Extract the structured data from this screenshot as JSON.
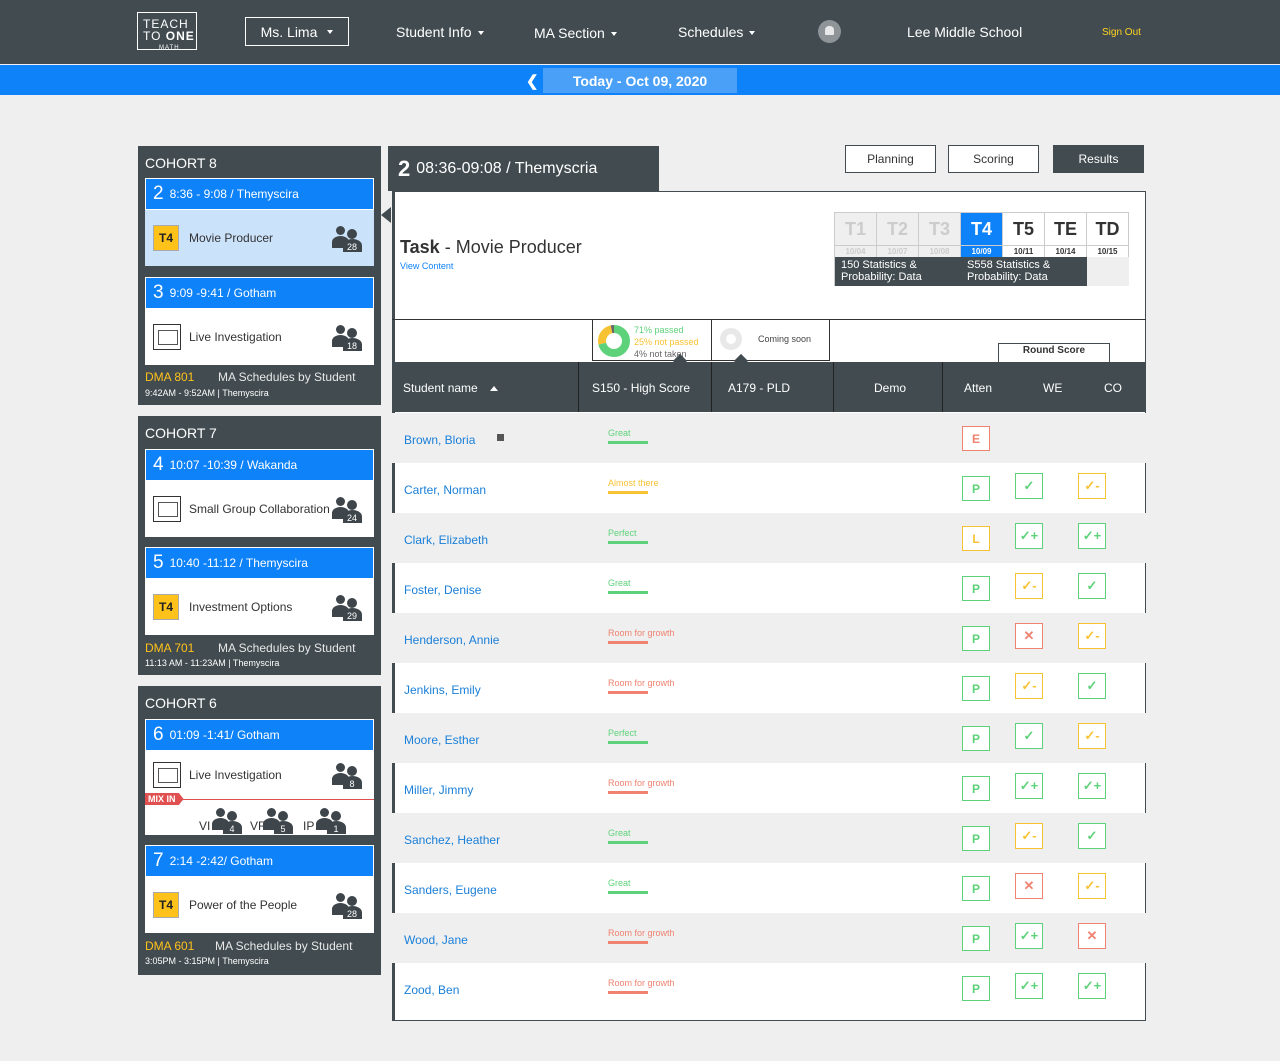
{
  "header": {
    "logo": {
      "line1": "TEACH",
      "line2a": "TO",
      "line2b": "ONE",
      "line3": "MATH"
    },
    "teacher": "Ms. Lima",
    "nav": [
      "Student Info",
      "MA Section",
      "Schedules"
    ],
    "school": "Lee Middle School",
    "signout": "Sign Out"
  },
  "datebar": {
    "date": "Today - Oct 09, 2020",
    "back_icon": "chevron-left-icon"
  },
  "cohorts": [
    {
      "title": "COHORT 8",
      "sessions": [
        {
          "num": "2",
          "time": "8:36 - 9:08 / Themyscira",
          "badge": "T4",
          "activity": "Movie Producer",
          "count": "28"
        },
        {
          "num": "3",
          "time": "9:09 -9:41 / Gotham",
          "badge": "",
          "activity": "Live Investigation",
          "count": "18"
        }
      ],
      "code": "DMA 801",
      "label": "MA Schedules by Student",
      "footer_time": "9:42AM - 9:52AM | Themyscira"
    },
    {
      "title": "COHORT 7",
      "sessions": [
        {
          "num": "4",
          "time": "10:07 -10:39 / Wakanda",
          "badge": "",
          "activity": "Small Group Collaboration",
          "count": "24"
        },
        {
          "num": "5",
          "time": "10:40 -11:12 / Themyscira",
          "badge": "T4",
          "activity": "Investment Options",
          "count": "29"
        }
      ],
      "code": "DMA 701",
      "label": "MA Schedules by Student",
      "footer_time": "11:13 AM - 11:23AM | Themyscira"
    },
    {
      "title": "COHORT 6",
      "sessions": [
        {
          "num": "6",
          "time": "01:09 -1:41/ Gotham",
          "badge": "",
          "activity": "Live Investigation",
          "count": "8",
          "mixin": {
            "label": "MIX IN",
            "groups": [
              {
                "name": "VI",
                "count": "4"
              },
              {
                "name": "VR",
                "count": "5"
              },
              {
                "name": "IP",
                "count": "1"
              }
            ]
          }
        },
        {
          "num": "7",
          "time": "2:14 -2:42/ Gotham",
          "badge": "T4",
          "activity": "Power of the People",
          "count": "28"
        }
      ],
      "code": "DMA 601",
      "label": "MA Schedules by Student",
      "footer_time": "3:05PM - 3:15PM | Themyscira"
    }
  ],
  "main": {
    "session_num": "2",
    "session_title": "08:36-09:08 / Themyscria",
    "buttons": [
      "Planning",
      "Scoring",
      "Results"
    ],
    "task_label": "Task",
    "task_name": " - Movie Producer",
    "view_content": "View Content",
    "tiers": [
      {
        "name": "T1",
        "date": "10/04",
        "state": "past"
      },
      {
        "name": "T2",
        "date": "10/07",
        "state": "past"
      },
      {
        "name": "T3",
        "date": "10/08",
        "state": "past"
      },
      {
        "name": "T4",
        "date": "10/09",
        "state": "current"
      },
      {
        "name": "T5",
        "date": "10/11",
        "state": "future"
      },
      {
        "name": "TE",
        "date": "10/14",
        "state": "future"
      },
      {
        "name": "TD",
        "date": "10/15",
        "state": "future"
      }
    ],
    "tier_info": [
      "150 Statistics & Probability: Data",
      "S558 Statistics & Probability: Data"
    ],
    "pass_summary": {
      "passed": "71% passed",
      "not_passed": "25% not passed",
      "not_taken": "4% not taken",
      "passed_pct": 71,
      "not_passed_pct": 25,
      "not_taken_pct": 4
    },
    "coming_soon": "Coming soon",
    "round_score": "Round Score",
    "columns": [
      "Student name",
      "S150 - High Score",
      "A179 - PLD",
      "Demo",
      "Atten",
      "WE",
      "CO"
    ],
    "students": [
      {
        "name": "Brown, Bloria",
        "result": "Great",
        "atten": "E",
        "we": "",
        "co": ""
      },
      {
        "name": "Carter, Norman",
        "result": "Almost there",
        "atten": "P",
        "we": "✓",
        "co": "✓-"
      },
      {
        "name": "Clark, Elizabeth",
        "result": "Perfect",
        "atten": "L",
        "we": "✓+",
        "co": "✓+"
      },
      {
        "name": "Foster, Denise",
        "result": "Great",
        "atten": "P",
        "we": "✓-",
        "co": "✓"
      },
      {
        "name": "Henderson, Annie",
        "result": "Room for growth",
        "atten": "P",
        "we": "✕",
        "co": "✓-"
      },
      {
        "name": "Jenkins, Emily",
        "result": "Room for growth",
        "atten": "P",
        "we": "✓-",
        "co": "✓"
      },
      {
        "name": "Moore, Esther",
        "result": "Perfect",
        "atten": "P",
        "we": "✓",
        "co": "✓-"
      },
      {
        "name": "Miller, Jimmy",
        "result": "Room for growth",
        "atten": "P",
        "we": "✓+",
        "co": "✓+"
      },
      {
        "name": "Sanchez, Heather",
        "result": "Great",
        "atten": "P",
        "we": "✓-",
        "co": "✓"
      },
      {
        "name": "Sanders, Eugene",
        "result": "Great",
        "atten": "P",
        "we": "✕",
        "co": "✓-"
      },
      {
        "name": "Wood, Jane",
        "result": "Room for growth",
        "atten": "P",
        "we": "✓+",
        "co": "✕"
      },
      {
        "name": "Zood, Ben",
        "result": "Room for growth",
        "atten": "P",
        "we": "✓+",
        "co": "✓+"
      }
    ]
  },
  "colors": {
    "navy": "#414b50",
    "blue": "#0e82f8",
    "yellow": "#ffc21a",
    "green": "#5ed27a",
    "orange": "#f7c233",
    "red": "#ef8270",
    "link": "#1a7fd8"
  }
}
